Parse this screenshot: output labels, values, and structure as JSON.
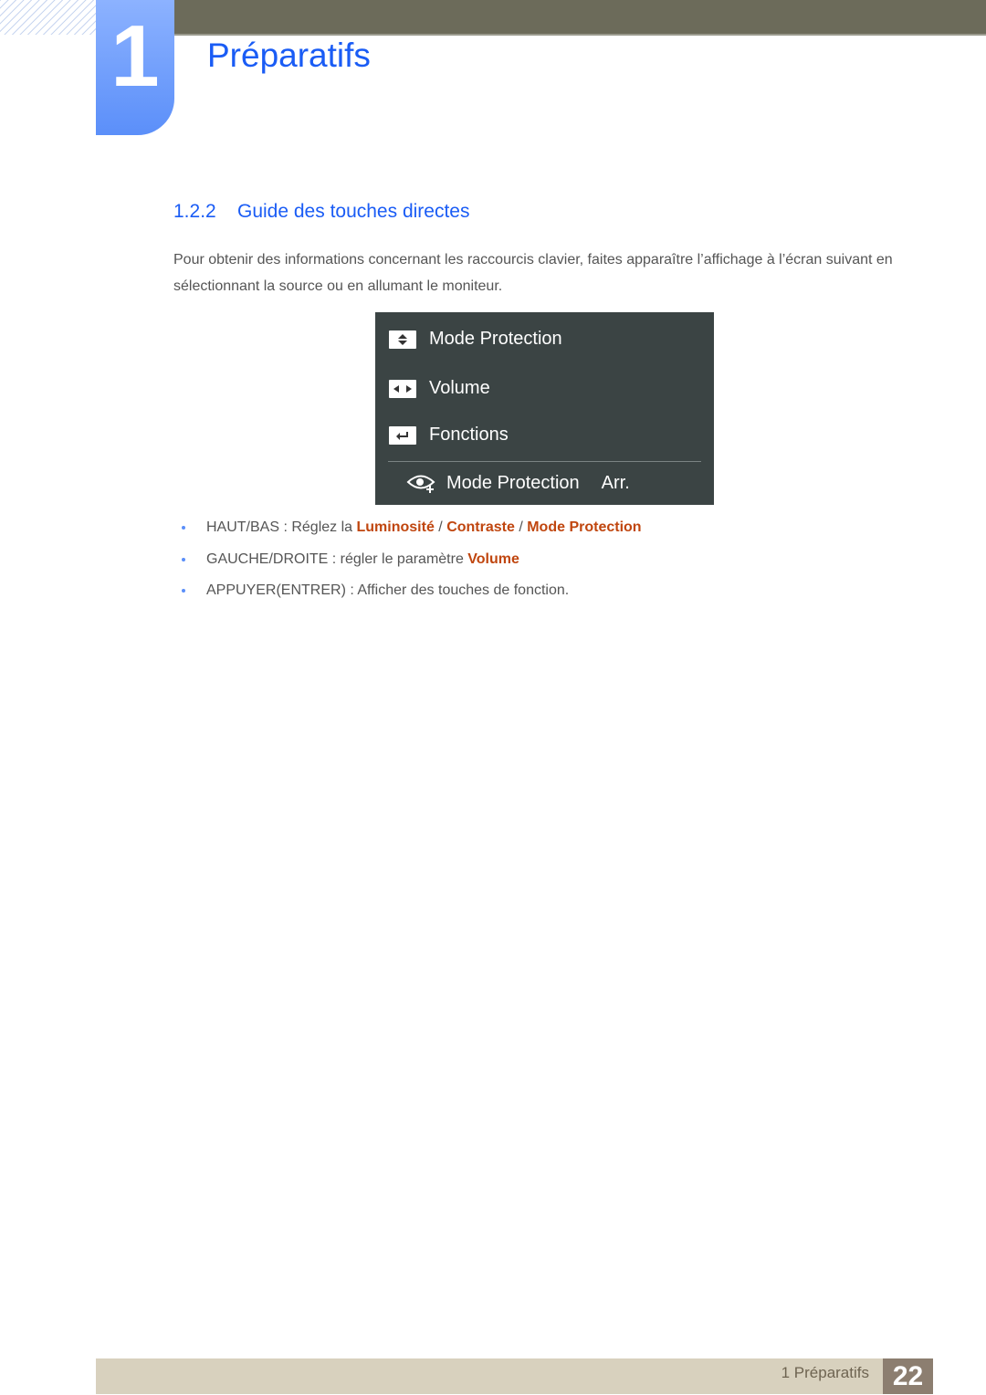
{
  "chapter": {
    "number": "1",
    "title": "Préparatifs"
  },
  "section": {
    "number": "1.2.2",
    "title": "Guide des touches directes"
  },
  "intro": "Pour obtenir des informations concernant les raccourcis clavier, faites apparaître l’affichage à l’écran suivant en sélectionnant la source ou en allumant le moniteur.",
  "osd": {
    "rows": [
      {
        "icon": "up-down-key-icon",
        "label": "Mode Protection"
      },
      {
        "icon": "left-right-key-icon",
        "label": "Volume"
      },
      {
        "icon": "enter-key-icon",
        "label": "Fonctions"
      }
    ],
    "status": {
      "icon": "eye-protection-icon",
      "label": "Mode Protection",
      "value": "Arr."
    }
  },
  "bullets": [
    {
      "prefix": "HAUT/BAS : Réglez la ",
      "h1": "Luminosité",
      "sep1": " / ",
      "h2": "Contraste",
      "sep2": " / ",
      "h3": "Mode Protection"
    },
    {
      "prefix": "GAUCHE/DROITE : régler le paramètre ",
      "h1": "Volume"
    },
    {
      "prefix": "APPUYER(ENTRER) : Afficher des touches de fonction."
    }
  ],
  "footer": {
    "label": "1 Préparatifs",
    "page": "22"
  },
  "colors": {
    "accent_blue": "#1a5cf5",
    "highlight_orange": "#c0460f",
    "osd_bg": "#3b4444"
  }
}
